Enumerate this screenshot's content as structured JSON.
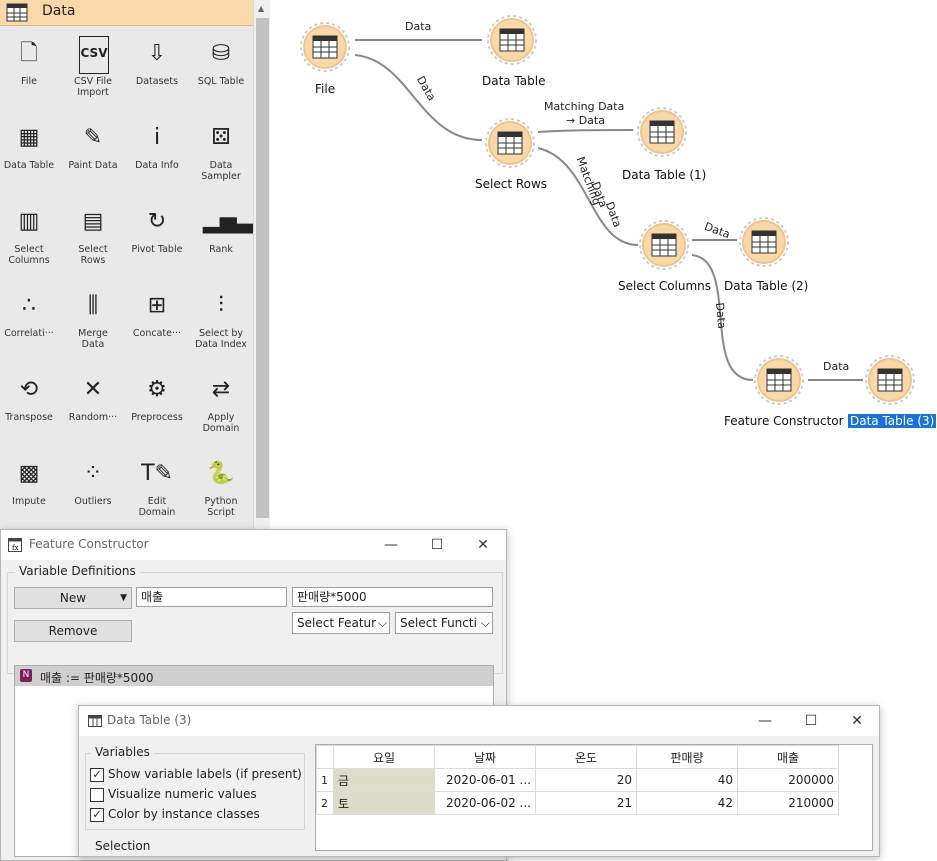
{
  "toolbox": {
    "category": "Data",
    "tools": [
      {
        "label": "File",
        "icon": "file-icon"
      },
      {
        "label": "CSV File\nImport",
        "icon": "csv-icon"
      },
      {
        "label": "Datasets",
        "icon": "datasets-icon"
      },
      {
        "label": "SQL Table",
        "icon": "database-icon"
      },
      {
        "label": "Data Table",
        "icon": "table-icon"
      },
      {
        "label": "Paint Data",
        "icon": "paint-icon"
      },
      {
        "label": "Data Info",
        "icon": "info-icon"
      },
      {
        "label": "Data\nSampler",
        "icon": "sampler-icon"
      },
      {
        "label": "Select\nColumns",
        "icon": "select-columns-icon"
      },
      {
        "label": "Select\nRows",
        "icon": "select-rows-icon"
      },
      {
        "label": "Pivot Table",
        "icon": "pivot-icon"
      },
      {
        "label": "Rank",
        "icon": "rank-icon"
      },
      {
        "label": "Correlati···",
        "icon": "correlations-icon"
      },
      {
        "label": "Merge\nData",
        "icon": "merge-icon"
      },
      {
        "label": "Concate···",
        "icon": "concatenate-icon"
      },
      {
        "label": "Select by\nData Index",
        "icon": "select-by-index-icon"
      },
      {
        "label": "Transpose",
        "icon": "transpose-icon"
      },
      {
        "label": "Random···",
        "icon": "randomize-icon"
      },
      {
        "label": "Preprocess",
        "icon": "preprocess-icon"
      },
      {
        "label": "Apply\nDomain",
        "icon": "apply-domain-icon"
      },
      {
        "label": "Impute",
        "icon": "impute-icon"
      },
      {
        "label": "Outliers",
        "icon": "outliers-icon"
      },
      {
        "label": "Edit\nDomain",
        "icon": "edit-domain-icon"
      },
      {
        "label": "Python\nScript",
        "icon": "python-icon"
      }
    ]
  },
  "workflow": {
    "nodes": {
      "file": "File",
      "data_table": "Data Table",
      "select_rows": "Select Rows",
      "data_table_1": "Data Table (1)",
      "select_columns": "Select Columns",
      "data_table_2": "Data Table (2)",
      "feature_constructor": "Feature Constructor",
      "data_table_3": "Data Table (3)"
    },
    "links": {
      "file_to_table": "Data",
      "file_to_select_rows": "Data",
      "rows_to_table1_line1": "Matching Data",
      "rows_to_table1_line2": "→ Data",
      "rows_to_columns_line1": "Matching",
      "rows_to_columns_line2": "Data",
      "rows_to_columns_line3": "Data",
      "columns_to_table2": "Data",
      "columns_to_fc": "Data",
      "fc_to_table3": "Data"
    },
    "selected_color": "#1a73d4",
    "node_color": "#fbd8a9"
  },
  "feature_constructor": {
    "title": "Feature Constructor",
    "group_title": "Variable Definitions",
    "new_button": "New",
    "remove_button": "Remove",
    "name_value": "매출",
    "expression_value": "판매량*5000",
    "select_feature": "Select Featur",
    "select_function": "Select Functi",
    "variables": [
      {
        "type_badge": "N",
        "text": "매출 := 판매량*5000"
      }
    ]
  },
  "data_table_window": {
    "title": "Data Table (3)",
    "variables_group": "Variables",
    "checkboxes": [
      {
        "label": "Show variable labels (if present)",
        "checked": true
      },
      {
        "label": "Visualize numeric values",
        "checked": false
      },
      {
        "label": "Color by instance classes",
        "checked": true
      }
    ],
    "selection_group": "Selection",
    "columns": [
      "요일",
      "날짜",
      "온도",
      "판매량",
      "매출"
    ],
    "rows": [
      {
        "index": "1",
        "cells": [
          "금",
          "2020-06-01 ...",
          "20",
          "40",
          "200000"
        ]
      },
      {
        "index": "2",
        "cells": [
          "토",
          "2020-06-02 ...",
          "21",
          "42",
          "210000"
        ]
      }
    ]
  }
}
